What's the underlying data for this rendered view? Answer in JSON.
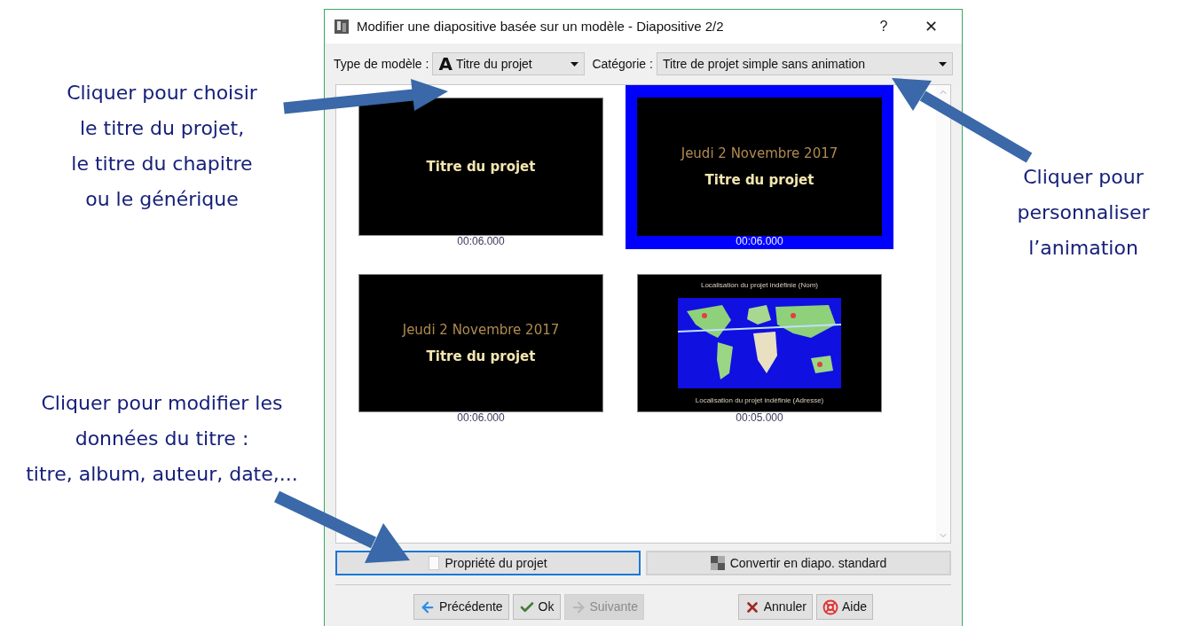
{
  "annotations_left": [
    {
      "lines": [
        "Cliquer pour choisir",
        "le titre du projet,",
        "le titre du chapitre",
        "ou le générique"
      ]
    },
    {
      "lines": [
        "Cliquer pour modifier les",
        "données du titre  :",
        "titre, album, auteur, date,..."
      ]
    }
  ],
  "annotations_right": [
    {
      "lines": [
        "Cliquer pour",
        "personnaliser",
        "l’animation"
      ]
    }
  ],
  "window": {
    "title": "Modifier une diapositive basée sur un modèle - Diapositive 2/2",
    "help": "?",
    "close": "✕"
  },
  "toolbar": {
    "type_label": "Type de modèle :",
    "type_glyph": "A",
    "type_value": "Titre du projet",
    "category_label": "Catégorie :",
    "category_value": "Titre de projet simple sans animation"
  },
  "slides": [
    {
      "kind": "text",
      "selected": false,
      "duration": "00:06.000",
      "lines": [
        {
          "kind": "title",
          "text": "Titre du projet"
        }
      ]
    },
    {
      "kind": "text",
      "selected": true,
      "duration": "00:06.000",
      "lines": [
        {
          "kind": "date",
          "text": "Jeudi 2 Novembre 2017"
        },
        {
          "kind": "title",
          "text": "Titre du projet"
        }
      ]
    },
    {
      "kind": "text",
      "selected": false,
      "duration": "00:06.000",
      "lines": [
        {
          "kind": "date",
          "text": "Jeudi 2 Novembre 2017"
        },
        {
          "kind": "title",
          "text": "Titre du projet"
        }
      ]
    },
    {
      "kind": "map",
      "selected": false,
      "duration": "00:05.000",
      "lines": [
        {
          "kind": "caption",
          "text": "Localisation du projet indéfinie (Nom)"
        },
        {
          "kind": "caption",
          "text": "Localisation du projet indéfinie (Adresse)"
        }
      ]
    }
  ],
  "actions": [
    {
      "kind": "properties",
      "label": "Propriété du projet",
      "focused": true
    },
    {
      "kind": "convert",
      "label": "Convertir en diapo. standard",
      "focused": false
    }
  ],
  "buttons": [
    {
      "kind": "previous",
      "label": "Précédente",
      "disabled": false
    },
    {
      "kind": "ok",
      "label": "Ok",
      "disabled": false
    },
    {
      "kind": "next",
      "label": "Suivante",
      "disabled": true
    },
    {
      "kind": "cancel",
      "label": "Annuler",
      "disabled": false
    },
    {
      "kind": "help",
      "label": "Aide",
      "disabled": false
    }
  ]
}
